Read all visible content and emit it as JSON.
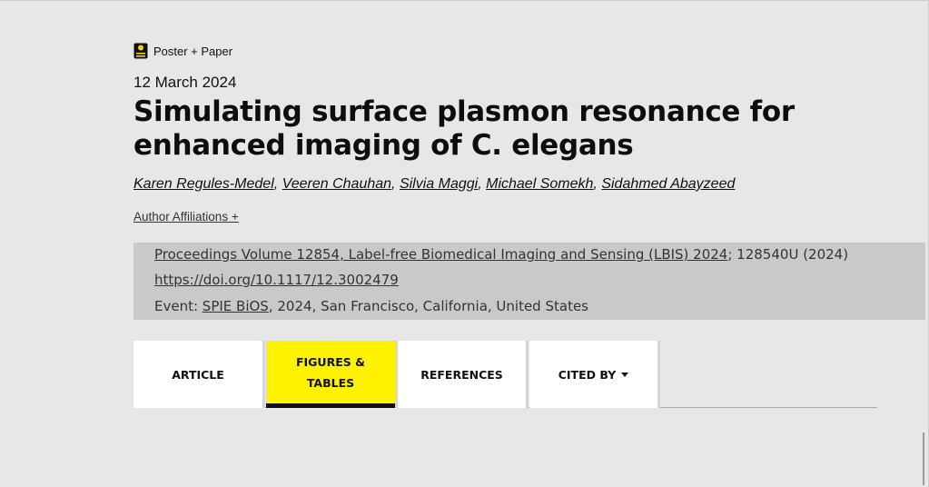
{
  "badge": {
    "label": "Poster + Paper",
    "icon": "poster-icon",
    "icon_color": "#f5d400"
  },
  "publication_date": "12 March 2024",
  "title": "Simulating surface plasmon resonance for enhanced imaging of C. elegans",
  "authors": [
    "Karen Regules-Medel",
    "Veeren Chauhan",
    "Silvia Maggi",
    "Michael Somekh",
    "Sidahmed Abayzeed"
  ],
  "author_separator": ",",
  "affiliations_link": "Author Affiliations +",
  "proceedings": {
    "volume_link": "Proceedings Volume 12854, Label-free Biomedical Imaging and Sensing (LBIS) 2024",
    "article_id": "; 128540U (2024)",
    "doi_link": "https://doi.org/10.1117/12.3002479",
    "event_prefix": "Event: ",
    "event_link": "SPIE BiOS",
    "event_rest": ", 2024, San Francisco, California, United States"
  },
  "tabs": [
    {
      "label": "ARTICLE",
      "active": false
    },
    {
      "label_line1": "FIGURES &",
      "label_line2": "TABLES",
      "active": true
    },
    {
      "label": "REFERENCES",
      "active": false
    },
    {
      "label": "CITED BY",
      "active": false,
      "icon": "caret-down-icon"
    }
  ],
  "colors": {
    "accent": "#fff200",
    "page_bg": "#e6e7e9",
    "info_box_bg": "#c9c9cb"
  }
}
